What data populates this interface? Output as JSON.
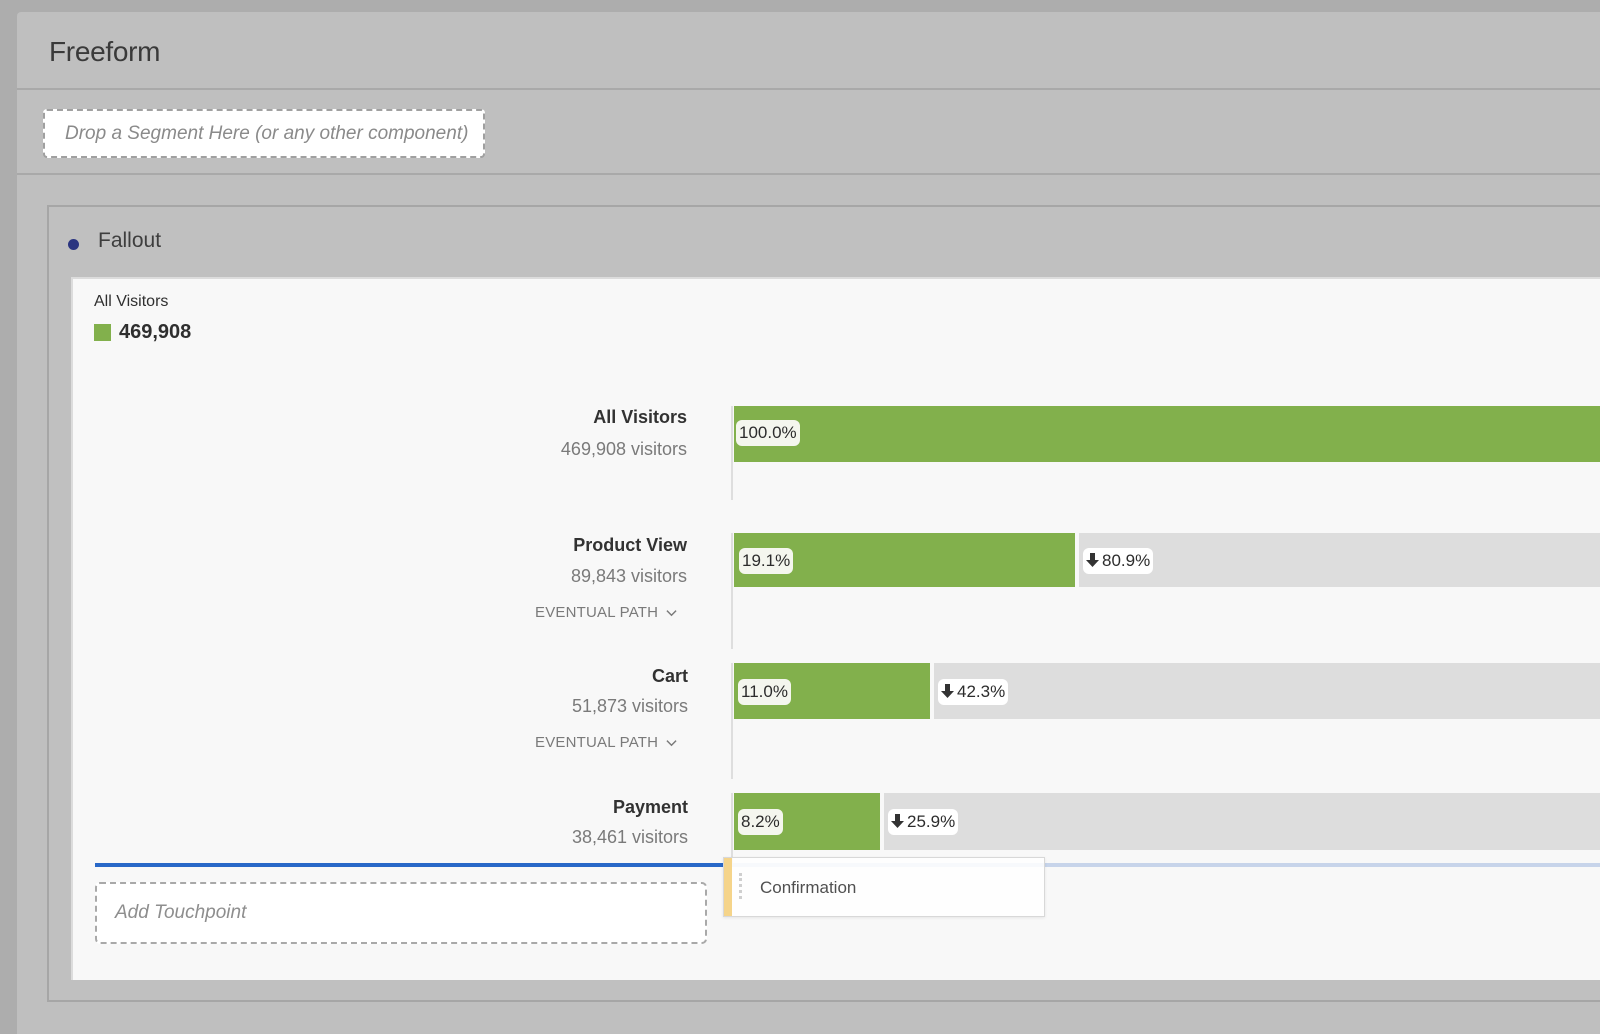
{
  "workspace": {
    "title": "Freeform",
    "segment_drop_zone": "Drop a Segment Here (or any other component)"
  },
  "panel": {
    "title": "Fallout",
    "legend": {
      "segment": "All Visitors",
      "total": "469,908",
      "color": "#82b04c"
    },
    "steps": [
      {
        "name": "All Visitors",
        "visitors": "469,908 visitors",
        "percent_label": "100.0%",
        "percent": 100.0,
        "fallout_label": null,
        "eventual_path": null
      },
      {
        "name": "Product View",
        "visitors": "89,843 visitors",
        "percent_label": "19.1%",
        "percent": 19.1,
        "fallout_label": "80.9%",
        "eventual_path": "EVENTUAL PATH"
      },
      {
        "name": "Cart",
        "visitors": "51,873 visitors",
        "percent_label": "11.0%",
        "percent": 11.0,
        "fallout_label": "42.3%",
        "eventual_path": "EVENTUAL PATH"
      },
      {
        "name": "Payment",
        "visitors": "38,461 visitors",
        "percent_label": "8.2%",
        "percent": 8.2,
        "fallout_label": "25.9%",
        "eventual_path": null
      }
    ],
    "add_touchpoint": "Add Touchpoint",
    "dragging_component": "Confirmation"
  },
  "colors": {
    "accent_green": "#82b04c",
    "fallout_gray": "#dddddd",
    "drop_indicator": "#2968c8",
    "panel_dot": "#2b3580"
  }
}
